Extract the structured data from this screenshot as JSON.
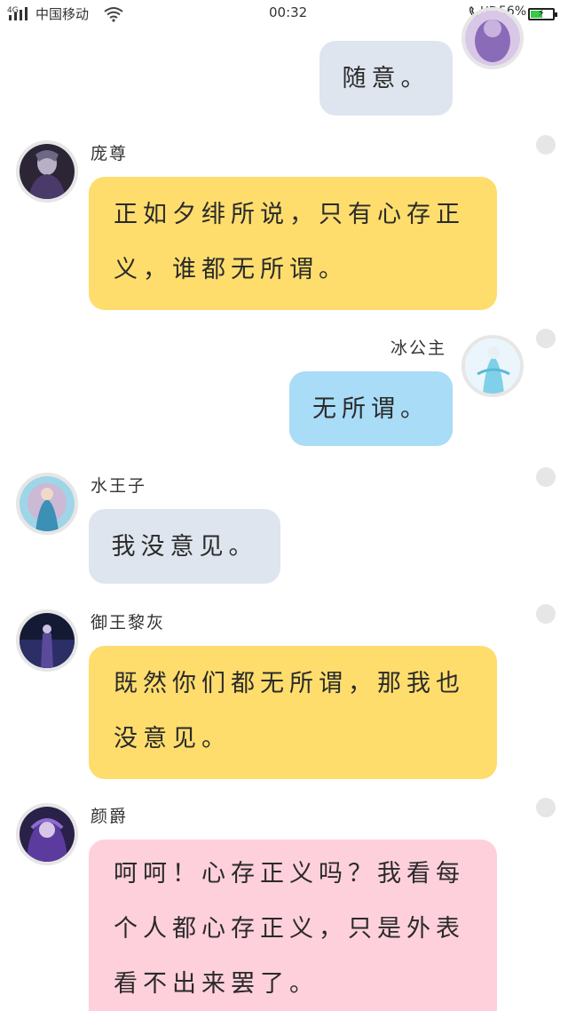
{
  "status_bar": {
    "network": "4G",
    "carrier": "中国移动",
    "time": "00:32",
    "hd": "HD",
    "battery": "56%",
    "battery_level": 0.56
  },
  "messages": [
    {
      "sender": "",
      "text": "随意。",
      "side": "right",
      "color": "#dee5ee"
    },
    {
      "sender": "庞尊",
      "text": "正如夕绯所说，只有心存正义，谁都无所谓。",
      "side": "left",
      "color": "#fedd6d"
    },
    {
      "sender": "冰公主",
      "text": "无所谓。",
      "side": "right",
      "color": "#a8dcf7"
    },
    {
      "sender": "水王子",
      "text": "我没意见。",
      "side": "left",
      "color": "#dee5ee"
    },
    {
      "sender": "御王黎灰",
      "text": "既然你们都无所谓，那我也没意见。",
      "side": "left",
      "color": "#fedd6d"
    },
    {
      "sender": "颜爵",
      "text": "呵呵！心存正义吗？我看每个人都心存正义，只是外表看不出来罢了。",
      "side": "left",
      "color": "#fed0dc"
    }
  ],
  "icons": [
    "signal-icon",
    "wifi-icon",
    "phone-icon",
    "battery-icon",
    "avatar",
    "options-dot"
  ]
}
